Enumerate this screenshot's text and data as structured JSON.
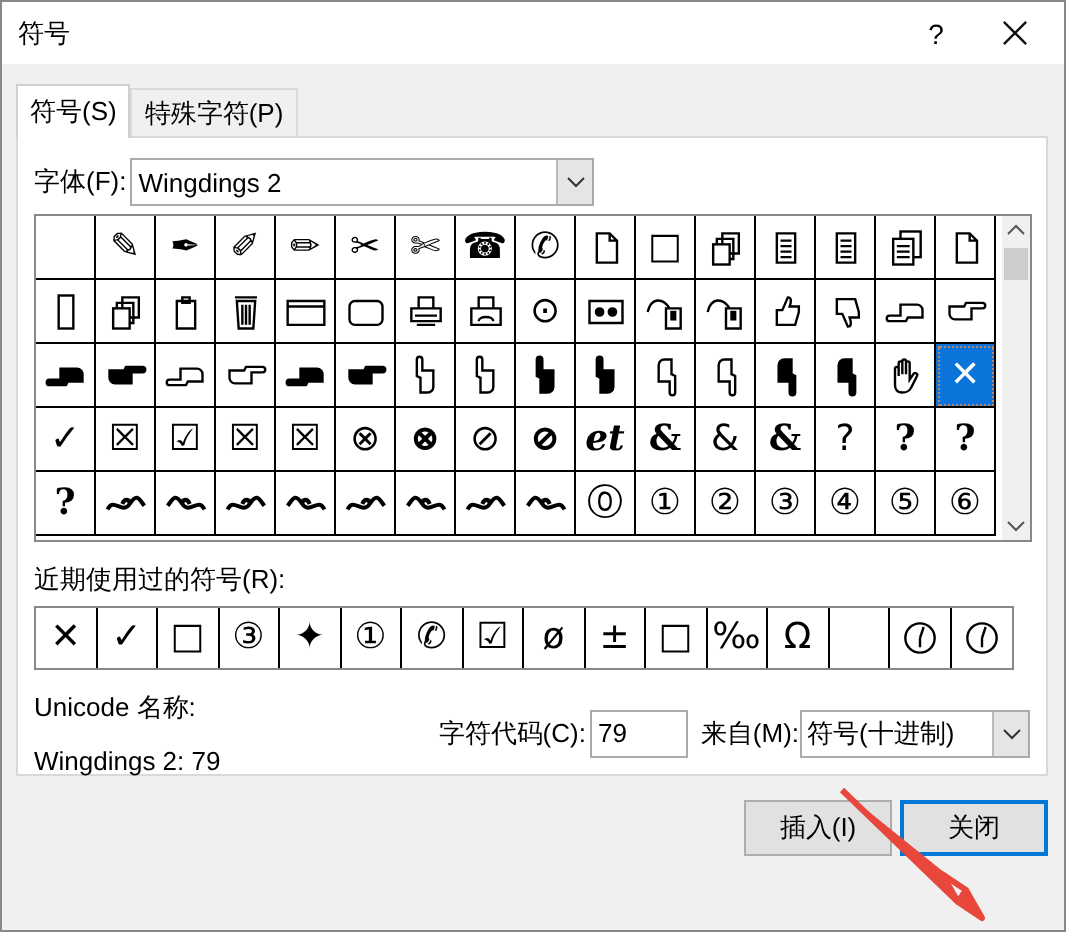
{
  "window": {
    "title": "符号",
    "help": "?"
  },
  "tabs": [
    {
      "label": "符号(S)",
      "selected": true
    },
    {
      "label": "特殊字符(P)",
      "selected": false
    }
  ],
  "font": {
    "label": "字体(F):",
    "value": "Wingdings 2"
  },
  "grid": [
    {
      "kind": "empty",
      "selected": false
    },
    {
      "kind": "glyph",
      "text": "✎",
      "selected": false
    },
    {
      "kind": "glyph",
      "text": "✒",
      "selected": false
    },
    {
      "kind": "glyph",
      "text": "✐",
      "selected": false
    },
    {
      "kind": "glyph",
      "text": "✏",
      "selected": false
    },
    {
      "kind": "glyph",
      "text": "✂",
      "selected": false
    },
    {
      "kind": "glyph",
      "text": "✄",
      "selected": false
    },
    {
      "kind": "glyph",
      "text": "☎",
      "selected": false
    },
    {
      "kind": "glyph",
      "text": "✆",
      "selected": false
    },
    {
      "kind": "icon",
      "selected": false
    },
    {
      "kind": "glyph",
      "text": "□",
      "selected": false
    },
    {
      "kind": "icon",
      "selected": false
    },
    {
      "kind": "icon",
      "selected": false
    },
    {
      "kind": "icon",
      "selected": false
    },
    {
      "kind": "icon",
      "selected": false
    },
    {
      "kind": "icon",
      "selected": false
    },
    {
      "kind": "icon",
      "selected": false
    },
    {
      "kind": "icon",
      "selected": false
    },
    {
      "kind": "icon",
      "selected": false
    },
    {
      "kind": "icon",
      "selected": false
    },
    {
      "kind": "icon",
      "selected": false
    },
    {
      "kind": "icon",
      "selected": false
    },
    {
      "kind": "icon",
      "selected": false
    },
    {
      "kind": "icon",
      "selected": false
    },
    {
      "kind": "glyph",
      "text": "⊙",
      "selected": false
    },
    {
      "kind": "icon",
      "selected": false
    },
    {
      "kind": "icon",
      "selected": false
    },
    {
      "kind": "icon",
      "selected": false
    },
    {
      "kind": "icon",
      "selected": false
    },
    {
      "kind": "icon",
      "selected": false
    },
    {
      "kind": "icon",
      "selected": false
    },
    {
      "kind": "icon",
      "selected": false
    },
    {
      "kind": "icon",
      "selected": false
    },
    {
      "kind": "icon",
      "selected": false
    },
    {
      "kind": "icon",
      "selected": false
    },
    {
      "kind": "icon",
      "selected": false
    },
    {
      "kind": "icon",
      "selected": false
    },
    {
      "kind": "icon",
      "selected": false
    },
    {
      "kind": "icon",
      "selected": false
    },
    {
      "kind": "icon",
      "selected": false
    },
    {
      "kind": "icon",
      "selected": false
    },
    {
      "kind": "icon",
      "selected": false
    },
    {
      "kind": "icon",
      "selected": false
    },
    {
      "kind": "icon",
      "selected": false
    },
    {
      "kind": "icon",
      "selected": false
    },
    {
      "kind": "icon",
      "selected": false
    },
    {
      "kind": "icon",
      "selected": false
    },
    {
      "kind": "glyph",
      "text": "✕",
      "selected": true
    },
    {
      "kind": "glyph",
      "text": "✓",
      "selected": false
    },
    {
      "kind": "glyph",
      "text": "☒",
      "selected": false
    },
    {
      "kind": "glyph",
      "text": "☑",
      "selected": false
    },
    {
      "kind": "glyph",
      "text": "☒",
      "selected": false
    },
    {
      "kind": "glyph",
      "text": "☒",
      "selected": false
    },
    {
      "kind": "glyph",
      "text": "⊗",
      "selected": false
    },
    {
      "kind": "glyph",
      "text": "⊗",
      "bold": true,
      "selected": false
    },
    {
      "kind": "glyph",
      "text": "⊘",
      "selected": false
    },
    {
      "kind": "glyph",
      "text": "⊘",
      "bold": true,
      "selected": false
    },
    {
      "kind": "glyph",
      "text": "et",
      "bold": true,
      "italic": true,
      "selected": false
    },
    {
      "kind": "glyph",
      "text": "&",
      "bold": true,
      "selected": false
    },
    {
      "kind": "glyph",
      "text": "&",
      "selected": false
    },
    {
      "kind": "glyph",
      "text": "&",
      "bold": true,
      "selected": false
    },
    {
      "kind": "glyph",
      "text": "?",
      "selected": false
    },
    {
      "kind": "glyph",
      "text": "?",
      "bold": true,
      "selected": false
    },
    {
      "kind": "glyph",
      "text": "?",
      "bold": true,
      "selected": false
    },
    {
      "kind": "glyph",
      "text": "?",
      "bold": true,
      "selected": false
    },
    {
      "kind": "icon",
      "selected": false
    },
    {
      "kind": "icon",
      "selected": false
    },
    {
      "kind": "icon",
      "selected": false
    },
    {
      "kind": "icon",
      "selected": false
    },
    {
      "kind": "icon",
      "selected": false
    },
    {
      "kind": "icon",
      "selected": false
    },
    {
      "kind": "icon",
      "selected": false
    },
    {
      "kind": "icon",
      "selected": false
    },
    {
      "kind": "glyph",
      "text": "⓪",
      "selected": false
    },
    {
      "kind": "glyph",
      "text": "①",
      "selected": false
    },
    {
      "kind": "glyph",
      "text": "②",
      "selected": false
    },
    {
      "kind": "glyph",
      "text": "③",
      "selected": false
    },
    {
      "kind": "glyph",
      "text": "④",
      "selected": false
    },
    {
      "kind": "glyph",
      "text": "⑤",
      "selected": false
    },
    {
      "kind": "glyph",
      "text": "⑥",
      "selected": false
    }
  ],
  "recent": {
    "label": "近期使用过的符号(R):",
    "items": [
      {
        "kind": "glyph",
        "text": "✕"
      },
      {
        "kind": "glyph",
        "text": "✓"
      },
      {
        "kind": "glyph",
        "text": "□"
      },
      {
        "kind": "glyph",
        "text": "③"
      },
      {
        "kind": "glyph",
        "text": "✦"
      },
      {
        "kind": "glyph",
        "text": "①"
      },
      {
        "kind": "glyph",
        "text": "✆"
      },
      {
        "kind": "glyph",
        "text": "☑"
      },
      {
        "kind": "glyph",
        "text": "ø"
      },
      {
        "kind": "glyph",
        "text": "±"
      },
      {
        "kind": "glyph",
        "text": "□"
      },
      {
        "kind": "glyph",
        "text": "‰"
      },
      {
        "kind": "glyph",
        "text": "Ω"
      },
      {
        "kind": "empty"
      },
      {
        "kind": "icon"
      },
      {
        "kind": "icon"
      }
    ]
  },
  "unicode_name": {
    "label": "Unicode 名称:",
    "value": "Wingdings 2: 79"
  },
  "char_code": {
    "label": "字符代码(C):",
    "value": "79"
  },
  "from": {
    "label": "来自(M):",
    "value": "符号(十进制)"
  },
  "buttons": [
    {
      "label": "插入(I)",
      "focused": false
    },
    {
      "label": "关闭",
      "focused": true
    }
  ],
  "annotation_arrow": true
}
